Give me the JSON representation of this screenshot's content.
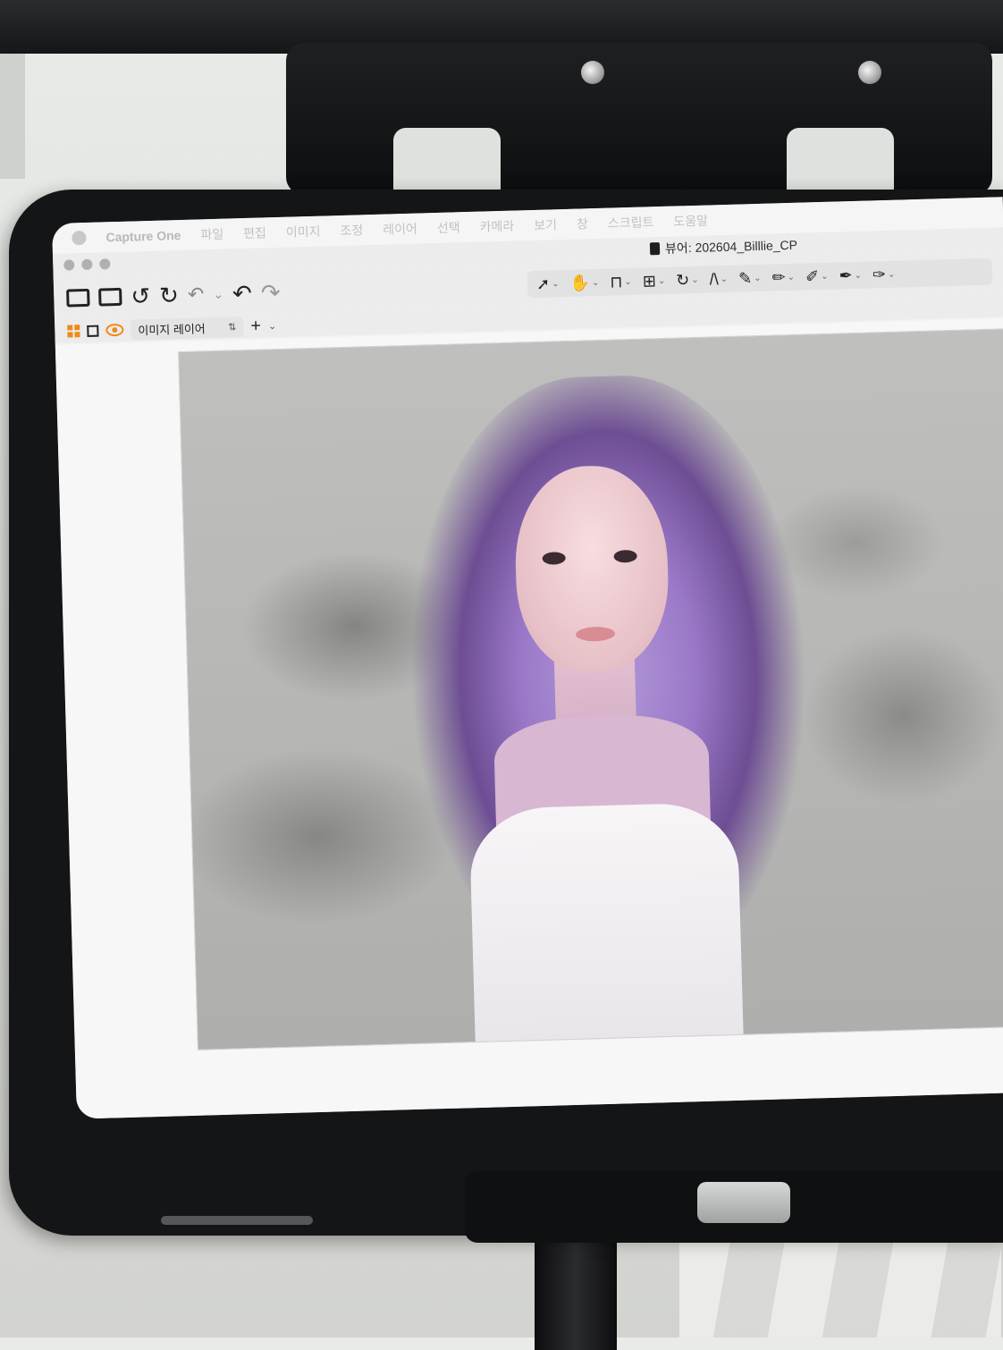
{
  "menubar": {
    "app_name": "Capture One",
    "items": [
      "파일",
      "편집",
      "이미지",
      "조정",
      "레이어",
      "선택",
      "카메라",
      "보기",
      "창",
      "스크립트",
      "도움말"
    ]
  },
  "window": {
    "title": "뷰어: 202604_Billlie_CP"
  },
  "toolbar": {
    "icons": [
      "import-icon",
      "export-icon",
      "rotate-left-icon",
      "rotate-right-icon",
      "undo-icon",
      "redo-icon"
    ],
    "tools": [
      "cursor-icon",
      "pan-icon",
      "crop-icon",
      "straighten-icon",
      "rotate-free-icon",
      "keystone-icon",
      "brush-icon",
      "eraser-icon",
      "gradient-icon",
      "picker-icon",
      "annotation-icon"
    ]
  },
  "layerbar": {
    "layer_name": "이미지 레이어",
    "add_label": "+"
  },
  "colors": {
    "accent": "#ef8a1a",
    "hair": "#9a78c8"
  }
}
